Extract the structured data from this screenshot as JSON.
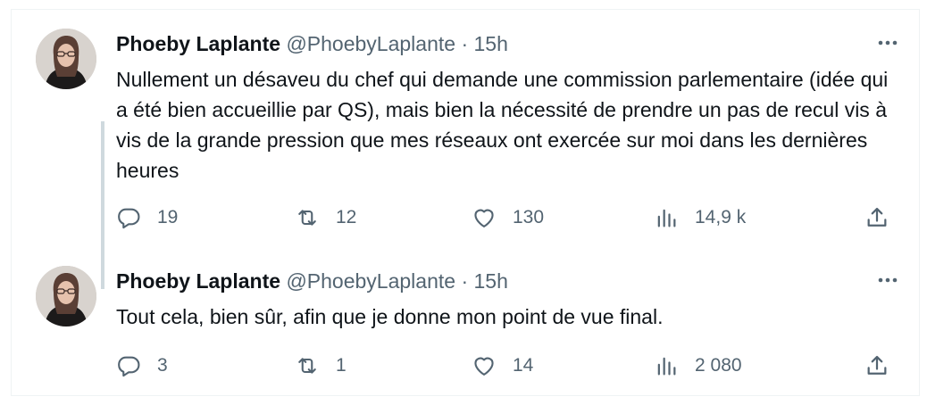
{
  "thread": {
    "tweets": [
      {
        "author": "Phoeby Laplante",
        "handle": "@PhoebyLaplante",
        "separator": "·",
        "time": "15h",
        "text": "Nullement un désaveu du chef qui demande une commission parlementaire (idée qui a été bien accueillie par QS), mais bien la nécessité de prendre un pas de recul vis à vis de la grande pression que mes réseaux ont exercée sur moi dans les dernières heures",
        "replies": "19",
        "retweets": "12",
        "likes": "130",
        "views": "14,9 k"
      },
      {
        "author": "Phoeby Laplante",
        "handle": "@PhoebyLaplante",
        "separator": "·",
        "time": "15h",
        "text": "Tout cela, bien sûr, afin que je donne mon point de vue final.",
        "replies": "3",
        "retweets": "1",
        "likes": "14",
        "views": "2 080"
      }
    ]
  },
  "icons": {
    "reply": "reply-icon",
    "retweet": "retweet-icon",
    "like": "heart-icon",
    "views": "views-icon",
    "share": "share-icon",
    "more": "more-icon"
  },
  "colors": {
    "text": "#0f1419",
    "secondary": "#536471",
    "thread_line": "#cfd9de",
    "border": "#eff3f4"
  }
}
